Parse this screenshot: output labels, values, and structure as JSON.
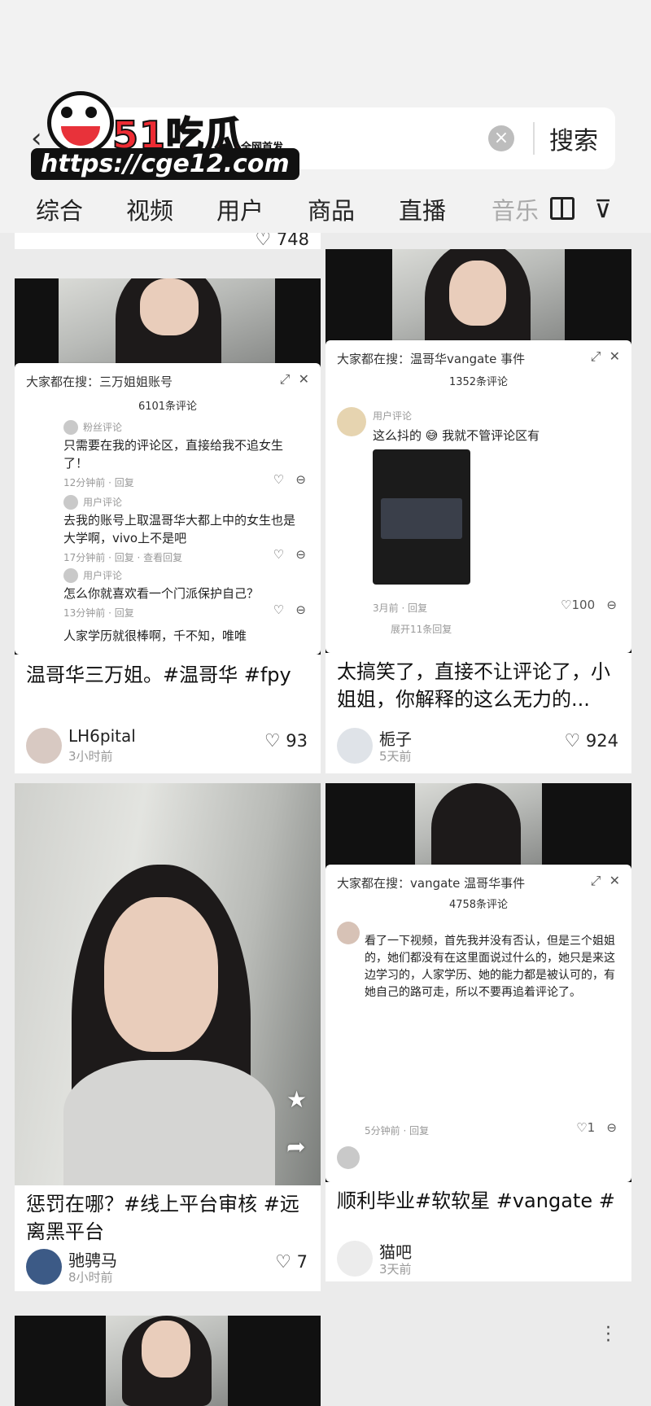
{
  "search": {
    "back_icon": "chevron-left-icon",
    "clear_icon": "clear-icon",
    "button_label": "搜索"
  },
  "watermark": {
    "brand": "51吃瓜",
    "badge": "全网首发",
    "url": "https://cge12.com"
  },
  "tabs": [
    {
      "label": "综合"
    },
    {
      "label": "视频"
    },
    {
      "label": "用户"
    },
    {
      "label": "商品"
    },
    {
      "label": "直播"
    },
    {
      "label": "音乐"
    }
  ],
  "tab_icons": {
    "layout": "layout-toggle-icon",
    "filter": "filter-icon"
  },
  "colors": {
    "brand_red": "#ee2b33",
    "background": "#ebebeb",
    "card": "#ffffff"
  },
  "feed": {
    "top_card": {
      "likes": "748"
    },
    "cards": [
      {
        "popup_header": "大家都在搜：三万姐姐账号",
        "popup_count": "6101条评论",
        "comments": [
          {
            "text": "只需要在我的评论区，直接给我不追女生了！",
            "meta": "12分钟前 · 回复"
          },
          {
            "text": "去我的账号上取温哥华大都上中的女生也是大学啊，vivo上不是吧",
            "meta": "17分钟前 · 回复 · 查看回复"
          },
          {
            "text": "怎么你就喜欢看一个门派保护自己？",
            "meta": "13分钟前 · 回复"
          },
          {
            "text": "人家学历就很棒啊，千不知，唯唯",
            "meta": ""
          }
        ],
        "title": "温哥华三万姐。#温哥华 #fpy",
        "author": "LH6pital",
        "time": "3小时前",
        "likes": "93"
      },
      {
        "popup_header": "大家都在搜：温哥华vangate 事件",
        "popup_count": "1352条评论",
        "comments": [
          {
            "text": "这么抖的 😅 我就不管评论区有",
            "meta": "3月前 · 回复"
          }
        ],
        "comment_likes": "100",
        "expand": "展开11条回复",
        "title": "太搞笑了，直接不让评论了，小姐姐，你解释的这么无力的...",
        "author": "栀子",
        "time": "5天前",
        "likes": "924"
      },
      {
        "title": "惩罚在哪？#线上平台审核 #远离黑平台",
        "author": "驰骋马",
        "time": "8小时前",
        "likes": "7"
      },
      {
        "popup_header": "大家都在搜：vangate 温哥华事件",
        "popup_count": "4758条评论",
        "comment_text": "看了一下视频，首先我并没有否认，但是三个姐姐的，她们都没有在这里面说过什么的，她只是来这边学习的，人家学历、她的能力都是被认可的，有她自己的路可走，所以不要再追着评论了。",
        "comment_meta": "5分钟前 · 回复",
        "comment_likes": "1",
        "title": "顺利毕业#软软星 #vangate #",
        "author": "猫吧",
        "time": "3天前"
      }
    ]
  }
}
